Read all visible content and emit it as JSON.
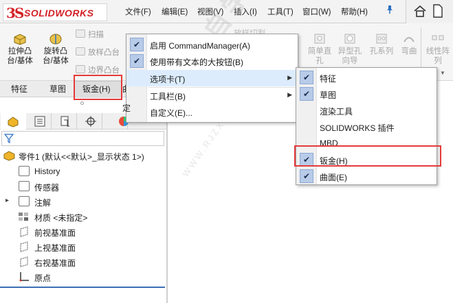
{
  "app": {
    "logo_ds": "3S",
    "logo_name": "SOLIDWORKS"
  },
  "menubar": [
    {
      "id": "file",
      "label": "文件(F)"
    },
    {
      "id": "edit",
      "label": "编辑(E)"
    },
    {
      "id": "view",
      "label": "视图(V)"
    },
    {
      "id": "insert",
      "label": "插入(I)"
    },
    {
      "id": "tools",
      "label": "工具(T)"
    },
    {
      "id": "window",
      "label": "窗口(W)"
    },
    {
      "id": "help",
      "label": "帮助(H)"
    }
  ],
  "command_manager": {
    "extrude_boss": "拉伸凸\n台/基体",
    "revolve_boss": "旋转凸\n台/基体",
    "sweep": "扫描",
    "loft": "放样凸台",
    "boundary": "边界凸台",
    "right_simple_hole": "简单直\n孔",
    "right_hole_wizard": "异型孔\n向导",
    "right_hole_series": "孔系列",
    "right_wrap": "弯曲",
    "right_linear_pattern": "线性阵\n列",
    "faded_top": "放样切割"
  },
  "tabs": [
    {
      "id": "features",
      "label": "特征"
    },
    {
      "id": "sketch",
      "label": "草图"
    },
    {
      "id": "sheetmetal",
      "label": "钣金(H)"
    },
    {
      "id": "surfaces_partial",
      "label": "曲"
    }
  ],
  "context_menu": {
    "items": [
      {
        "label": "启用 CommandManager(A)",
        "checked": true,
        "submenu": false
      },
      {
        "label": "使用带有文本的大按钮(B)",
        "checked": true,
        "submenu": false
      },
      {
        "label": "选项卡(T)",
        "checked": false,
        "submenu": true
      },
      {
        "label": "工具栏(B)",
        "checked": false,
        "submenu": true
      },
      {
        "label": "自定义(E)...",
        "checked": false,
        "submenu": false
      }
    ],
    "partial_left": "定"
  },
  "submenu": {
    "items": [
      {
        "label": "特征",
        "checked": true
      },
      {
        "label": "草图",
        "checked": true
      },
      {
        "label": "渲染工具",
        "checked": false
      },
      {
        "label": "SOLIDWORKS 插件",
        "checked": false
      },
      {
        "label": "MBD",
        "checked": false
      },
      {
        "label": "钣金(H)",
        "checked": true
      },
      {
        "label": "曲面(E)",
        "checked": true
      }
    ]
  },
  "tree": {
    "root": "零件1 (默认<<默认>_显示状态 1>)",
    "items": [
      {
        "label": "History"
      },
      {
        "label": "传感器"
      },
      {
        "label": "注解"
      },
      {
        "label": "材质 <未指定>"
      },
      {
        "label": "前视基准面"
      },
      {
        "label": "上视基准面"
      },
      {
        "label": "右视基准面"
      },
      {
        "label": "原点"
      }
    ]
  },
  "watermark": {
    "line1": "软件自学网",
    "line2": "WWW.RJZXW.COM"
  },
  "colors": {
    "brand": "#d42027",
    "highlight": "#e53a3a",
    "check_bg": "#b8cbe8"
  }
}
